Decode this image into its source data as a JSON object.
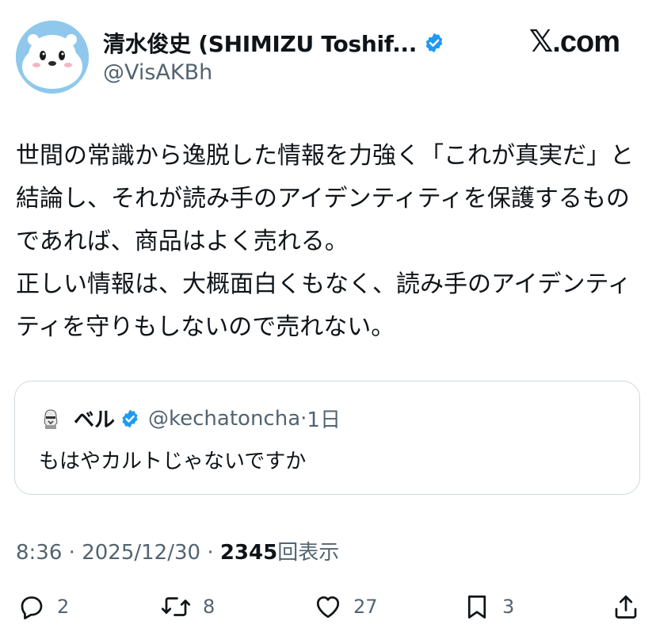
{
  "author": {
    "display_name": "清水俊史 (SHIMIZU Toshif...",
    "handle": "@VisAKBh",
    "verified": true,
    "avatar_icon": "seal-mascot-avatar"
  },
  "brand": "𝕏.com",
  "tweet": {
    "text": "世間の常識から逸脱した情報を力強く「これが真実だ」と結論し、それが読み手のアイデンティティを保護するものであれば、商品はよく売れる。\n正しい情報は、大概面白くもなく、読み手のアイデンティティを守りもしないので売れない。"
  },
  "quote": {
    "name": "ベル",
    "handle": "@kechatoncha",
    "separator": "·",
    "time": "1日",
    "text": "もはやカルトじゃないですか",
    "verified": true
  },
  "meta": {
    "time": "8:36",
    "sep1": "·",
    "date": "2025/12/30",
    "sep2": "·",
    "views": "2345",
    "views_label": "回表示"
  },
  "actions": {
    "replies": "2",
    "retweets": "8",
    "likes": "27",
    "bookmarks": "3"
  },
  "colors": {
    "verified_blue": "#1d9bf0",
    "secondary_text": "#536471",
    "border": "#cfd9de"
  }
}
